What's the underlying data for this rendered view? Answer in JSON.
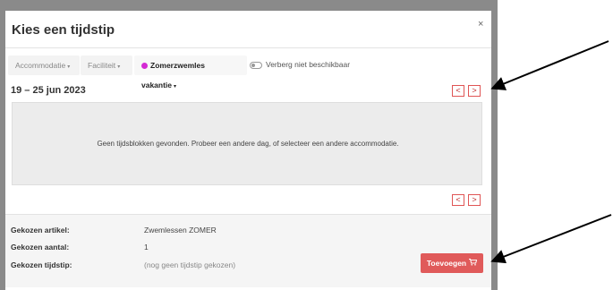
{
  "modal": {
    "title": "Kies een tijdstip",
    "close_label": "×"
  },
  "filters": {
    "accommodation_label": "Accommodatie",
    "facility_label": "Faciliteit",
    "active_label": "Zomerzwemles vakantie",
    "active_color": "#d42ad4",
    "toggle_label": "Verberg niet beschikbaar",
    "caret": "▾"
  },
  "week": {
    "label": "19 – 25 jun 2023",
    "prev_label": "<",
    "next_label": ">"
  },
  "empty_message": "Geen tijdsblokken gevonden. Probeer een andere dag, of selecteer een andere accommodatie.",
  "summary": {
    "article_label": "Gekozen artikel:",
    "article_value": "Zwemlessen ZOMER",
    "amount_label": "Gekozen aantal:",
    "amount_value": "1",
    "time_label": "Gekozen tijdstip:",
    "time_value": "(nog geen tijdstip gekozen)"
  },
  "add_button": {
    "label": "Toevoegen",
    "icon": "cart-icon",
    "color": "#e05a5a"
  }
}
